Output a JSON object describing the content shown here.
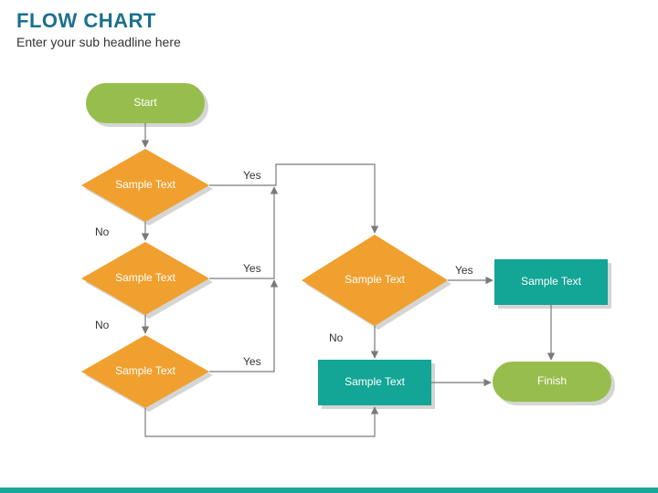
{
  "title": "FLOW CHART",
  "subtitle": "Enter your sub headline here",
  "nodes": {
    "start": {
      "label": "Start"
    },
    "d1": {
      "label": "Sample Text"
    },
    "d2": {
      "label": "Sample Text"
    },
    "d3": {
      "label": "Sample Text"
    },
    "d4": {
      "label": "Sample Text"
    },
    "p1": {
      "label": "Sample Text"
    },
    "p2": {
      "label": "Sample Text"
    },
    "finish": {
      "label": "Finish"
    }
  },
  "edges": {
    "d1_yes": "Yes",
    "d1_no": "No",
    "d2_yes": "Yes",
    "d2_no": "No",
    "d3_yes": "Yes",
    "d4_yes": "Yes",
    "d4_no": "No"
  },
  "colors": {
    "title": "#1b708d",
    "terminal": "#97be4d",
    "decision": "#f0a02e",
    "process": "#13a595",
    "footer": "#1ea59a"
  }
}
